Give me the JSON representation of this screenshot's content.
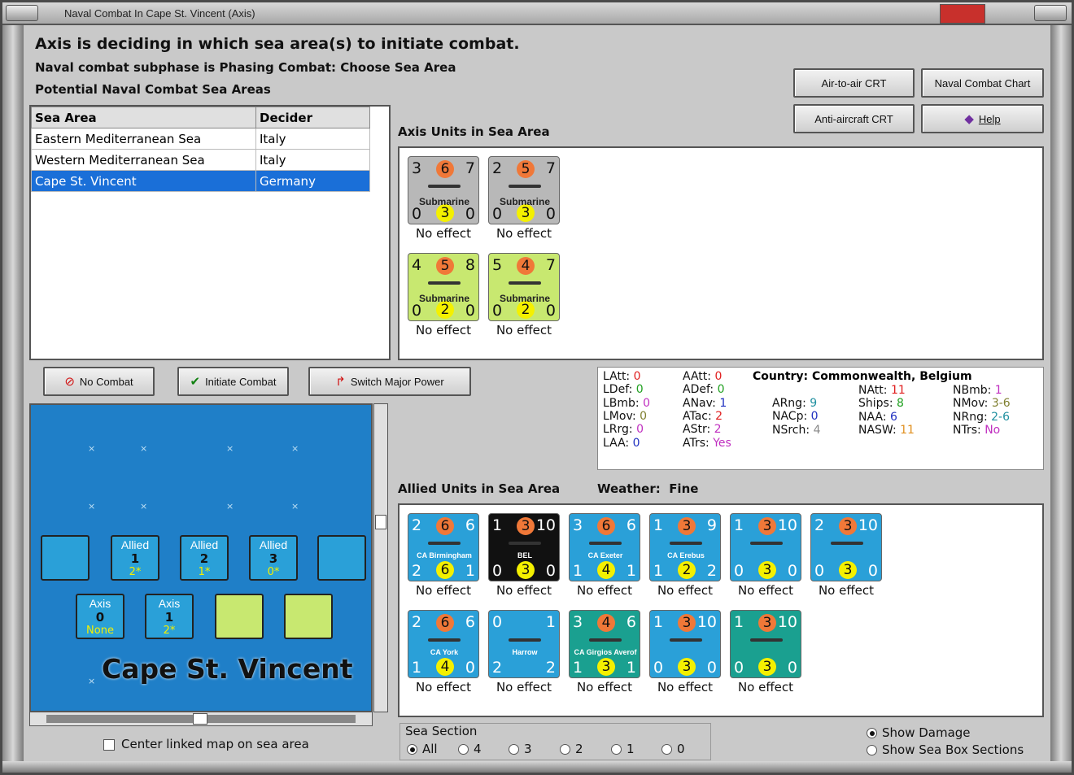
{
  "window": {
    "title": "Naval Combat In Cape St. Vincent (Axis)"
  },
  "header": {
    "line1": "Axis is deciding in which sea area(s) to initiate combat.",
    "line2": "Naval combat subphase is Phasing Combat: Choose Sea Area",
    "line3": "Potential Naval Combat Sea Areas"
  },
  "buttons": {
    "air_to_air": "Air-to-air CRT",
    "naval_chart": "Naval Combat Chart",
    "anti_aircraft": "Anti-aircraft CRT",
    "help": "Help",
    "no_combat": "No Combat",
    "initiate": "Initiate Combat",
    "switch": "Switch Major Power"
  },
  "sea_table": {
    "headers": [
      "Sea Area",
      "Decider"
    ],
    "rows": [
      [
        "Eastern Mediterranean Sea",
        "Italy"
      ],
      [
        "Western Mediterranean Sea",
        "Italy"
      ],
      [
        "Cape St. Vincent",
        "Germany"
      ]
    ]
  },
  "axis_units": {
    "label": "Axis Units in Sea Area",
    "units": [
      {
        "tl": "3",
        "top": "6",
        "tr": "7",
        "name": "Submarine",
        "bl": "0",
        "bot": "3",
        "br": "0",
        "effect": "No effect",
        "style": "sub"
      },
      {
        "tl": "2",
        "top": "5",
        "tr": "7",
        "name": "Submarine",
        "bl": "0",
        "bot": "3",
        "br": "0",
        "effect": "No effect",
        "style": "sub"
      },
      {
        "tl": "4",
        "top": "5",
        "tr": "8",
        "name": "Submarine",
        "bl": "0",
        "bot": "2",
        "br": "0",
        "effect": "No effect",
        "style": "subg"
      },
      {
        "tl": "5",
        "top": "4",
        "tr": "7",
        "name": "Submarine",
        "bl": "0",
        "bot": "2",
        "br": "0",
        "effect": "No effect",
        "style": "subg"
      }
    ]
  },
  "stats": {
    "country_label": "Country:",
    "country": "Commonwealth, Belgium",
    "col1": [
      [
        "LAtt:",
        "0",
        "red"
      ],
      [
        "LDef:",
        "0",
        "green"
      ],
      [
        "LBmb:",
        "0",
        "mag"
      ],
      [
        "LMov:",
        "0",
        "olive"
      ],
      [
        "LRrg:",
        "0",
        "mag"
      ],
      [
        "LAA:",
        "0",
        "blue"
      ]
    ],
    "col2": [
      [
        "AAtt:",
        "0",
        "red"
      ],
      [
        "ADef:",
        "0",
        "green"
      ],
      [
        "ANav:",
        "1",
        "blue"
      ],
      [
        "ATac:",
        "2",
        "red"
      ],
      [
        "AStr:",
        "2",
        "mag"
      ],
      [
        "ATrs:",
        "Yes",
        "mag"
      ]
    ],
    "col3": [
      [
        "ARng:",
        "9",
        "teal"
      ],
      [
        "NACp:",
        "0",
        "blue"
      ],
      [
        "NSrch:",
        "4",
        "gray"
      ]
    ],
    "col4": [
      [
        "NAtt:",
        "11",
        "red"
      ],
      [
        "Ships:",
        "8",
        "green"
      ],
      [
        "NAA:",
        "6",
        "blue"
      ],
      [
        "NASW:",
        "11",
        "orange"
      ]
    ],
    "col5": [
      [
        "NBmb:",
        "1",
        "mag"
      ],
      [
        "NMov:",
        "3-6",
        "olive"
      ],
      [
        "NRng:",
        "2-6",
        "teal"
      ],
      [
        "NTrs:",
        "No",
        "mag"
      ]
    ]
  },
  "allied_units": {
    "label": "Allied Units in Sea Area",
    "weather_label": "Weather:",
    "weather": "Fine",
    "units": [
      {
        "tl": "2",
        "top": "6",
        "tr": "6",
        "name": "CA Birmingham",
        "bl": "2",
        "bot": "6",
        "br": "1",
        "effect": "No effect",
        "style": "ship"
      },
      {
        "tl": "1",
        "top": "3",
        "tr": "10",
        "name": "BEL",
        "bl": "0",
        "bot": "3",
        "br": "0",
        "effect": "No effect",
        "style": "shipdk"
      },
      {
        "tl": "3",
        "top": "6",
        "tr": "6",
        "name": "CA Exeter",
        "bl": "1",
        "bot": "4",
        "br": "1",
        "effect": "No effect",
        "style": "ship"
      },
      {
        "tl": "1",
        "top": "3",
        "tr": "9",
        "name": "CA Erebus",
        "bl": "1",
        "bot": "2",
        "br": "2",
        "effect": "No effect",
        "style": "ship"
      },
      {
        "tl": "1",
        "top": "3",
        "tr": "10",
        "name": "",
        "bl": "0",
        "bot": "3",
        "br": "0",
        "effect": "No effect",
        "style": "ship"
      },
      {
        "tl": "2",
        "top": "3",
        "tr": "10",
        "name": "",
        "bl": "0",
        "bot": "3",
        "br": "0",
        "effect": "No effect",
        "style": "ship"
      },
      {
        "tl": "2",
        "top": "6",
        "tr": "6",
        "name": "CA York",
        "bl": "1",
        "bot": "4",
        "br": "0",
        "effect": "No effect",
        "style": "ship"
      },
      {
        "tl": "0",
        "top": "",
        "tr": "1",
        "name": "Harrow",
        "bl": "2",
        "bot": "",
        "br": "2",
        "effect": "No effect",
        "style": "ship"
      },
      {
        "tl": "3",
        "top": "4",
        "tr": "6",
        "name": "CA Girgios Averof",
        "bl": "1",
        "bot": "3",
        "br": "1",
        "effect": "No effect",
        "style": "teal"
      },
      {
        "tl": "1",
        "top": "3",
        "tr": "10",
        "name": "",
        "bl": "0",
        "bot": "3",
        "br": "0",
        "effect": "No effect",
        "style": "ship"
      },
      {
        "tl": "1",
        "top": "3",
        "tr": "10",
        "name": "",
        "bl": "0",
        "bot": "3",
        "br": "0",
        "effect": "No effect",
        "style": "teal"
      }
    ]
  },
  "map": {
    "name": "Cape St. Vincent",
    "boxes": [
      {
        "t": "Allied",
        "n": "1",
        "y": "2*"
      },
      {
        "t": "Allied",
        "n": "2",
        "y": "1*"
      },
      {
        "t": "Allied",
        "n": "3",
        "y": "0*"
      },
      {
        "t": "Axis",
        "n": "0",
        "y": "None"
      },
      {
        "t": "Axis",
        "n": "1",
        "y": "2*"
      }
    ],
    "center_label": "Center linked map on sea area"
  },
  "sea_section": {
    "label": "Sea Section",
    "options": [
      "All",
      "4",
      "3",
      "2",
      "1",
      "0"
    ]
  },
  "display": {
    "show_damage": "Show Damage",
    "show_sections": "Show Sea Box Sections"
  }
}
